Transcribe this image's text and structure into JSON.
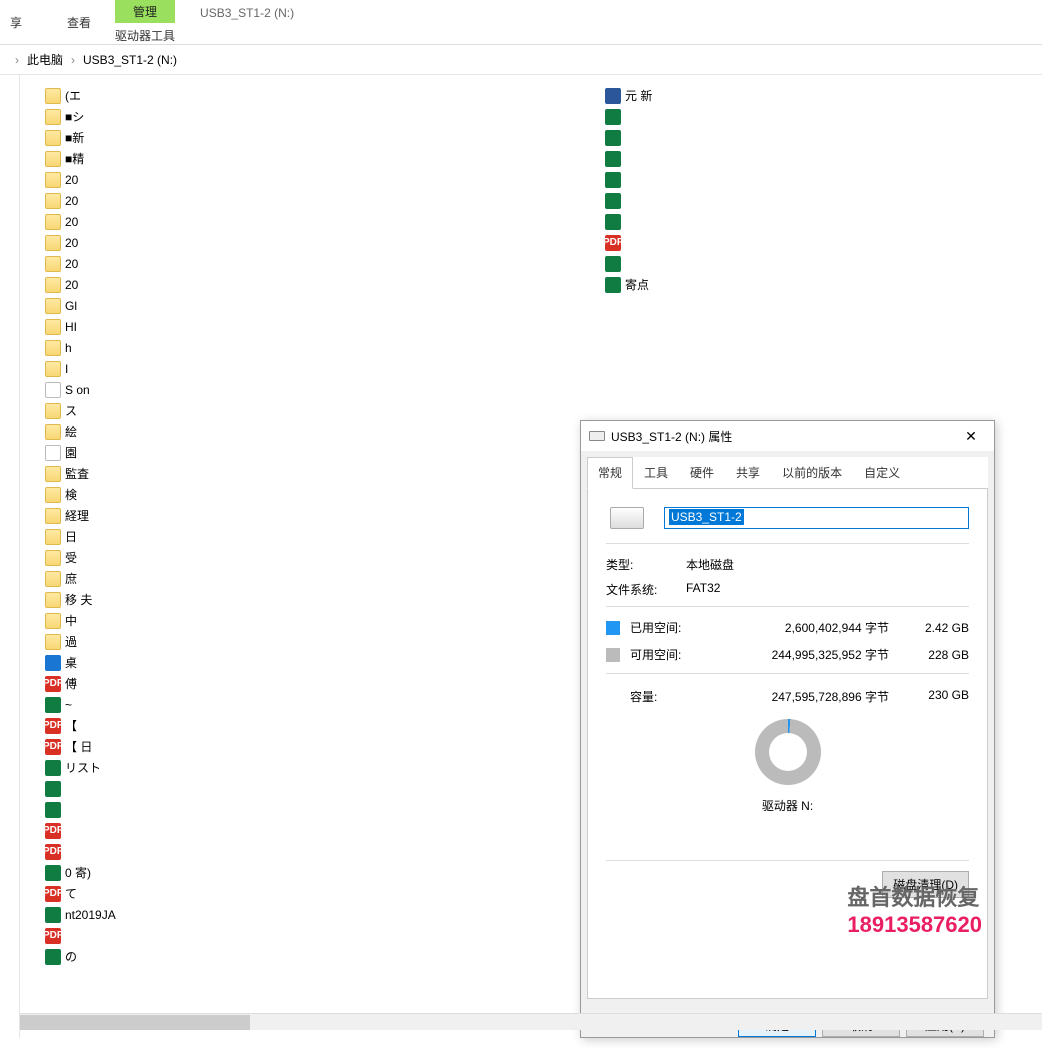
{
  "ribbon": {
    "context_tab": "管理",
    "context_label": "驱动器工具",
    "items": [
      "享",
      "查看"
    ],
    "drive_title": "USB3_ST1-2 (N:)"
  },
  "breadcrumb": {
    "sep": "›",
    "items": [
      "此电脑",
      "USB3_ST1-2 (N:)"
    ]
  },
  "files_col1": [
    {
      "icon": "folder",
      "label": "(エ"
    },
    {
      "icon": "folder",
      "label": "■シ"
    },
    {
      "icon": "folder",
      "label": "■新"
    },
    {
      "icon": "folder",
      "label": "■精"
    },
    {
      "icon": "folder",
      "label": "20"
    },
    {
      "icon": "folder",
      "label": "20"
    },
    {
      "icon": "folder",
      "label": "20"
    },
    {
      "icon": "folder",
      "label": "20"
    },
    {
      "icon": "folder",
      "label": "20"
    },
    {
      "icon": "folder",
      "label": "20"
    },
    {
      "icon": "folder",
      "label": "Gl"
    },
    {
      "icon": "folder",
      "label": "HI"
    },
    {
      "icon": "folder",
      "label": "h"
    },
    {
      "icon": "folder",
      "label": "I"
    },
    {
      "icon": "txt",
      "label": "S                                on"
    },
    {
      "icon": "folder",
      "label": "ス"
    },
    {
      "icon": "folder",
      "label": "絵"
    },
    {
      "icon": "txt",
      "label": "園"
    },
    {
      "icon": "folder",
      "label": "監査"
    },
    {
      "icon": "folder",
      "label": "検"
    },
    {
      "icon": "folder",
      "label": "経理"
    },
    {
      "icon": "folder",
      "label": "日"
    },
    {
      "icon": "folder",
      "label": "受"
    },
    {
      "icon": "folder",
      "label": "庶"
    },
    {
      "icon": "folder",
      "label": "移          夫"
    },
    {
      "icon": "folder",
      "label": "中"
    },
    {
      "icon": "folder",
      "label": "過"
    },
    {
      "icon": "desktop",
      "label": "桌"
    },
    {
      "icon": "pdf",
      "label": "傅"
    },
    {
      "icon": "xls",
      "label": "~"
    },
    {
      "icon": "pdf",
      "label": "【"
    },
    {
      "icon": "pdf",
      "label": "【                       日"
    },
    {
      "icon": "xls",
      "label": "                                        リスト"
    },
    {
      "icon": "xls",
      "label": ""
    },
    {
      "icon": "xls",
      "label": ""
    },
    {
      "icon": "pdf",
      "label": ""
    },
    {
      "icon": "pdf",
      "label": ""
    },
    {
      "icon": "xls",
      "label": "                           0            寄)"
    },
    {
      "icon": "pdf",
      "label": "                                  て"
    },
    {
      "icon": "xls",
      "label": "                              nt2019JA"
    },
    {
      "icon": "pdf",
      "label": ""
    },
    {
      "icon": "xls",
      "label": "                        の"
    }
  ],
  "files_col2": [
    {
      "icon": "doc",
      "label": "          元          新"
    },
    {
      "icon": "xls",
      "label": ""
    },
    {
      "icon": "xls",
      "label": ""
    },
    {
      "icon": "xls",
      "label": ""
    },
    {
      "icon": "xls",
      "label": ""
    },
    {
      "icon": "xls",
      "label": ""
    },
    {
      "icon": "xls",
      "label": ""
    },
    {
      "icon": "pdf",
      "label": ""
    },
    {
      "icon": "xls",
      "label": ""
    },
    {
      "icon": "xls",
      "label": "                       寄点"
    }
  ],
  "dialog": {
    "title": "USB3_ST1-2 (N:) 属性",
    "tabs": [
      "常规",
      "工具",
      "硬件",
      "共享",
      "以前的版本",
      "自定义"
    ],
    "name_value": "USB3_ST1-2",
    "type_label": "类型:",
    "type_value": "本地磁盘",
    "fs_label": "文件系统:",
    "fs_value": "FAT32",
    "used_label": "已用空间:",
    "used_bytes": "2,600,402,944 字节",
    "used_gb": "2.42 GB",
    "free_label": "可用空间:",
    "free_bytes": "244,995,325,952 字节",
    "free_gb": "228 GB",
    "cap_label": "容量:",
    "cap_bytes": "247,595,728,896 字节",
    "cap_gb": "230 GB",
    "drive_label": "驱动器 N:",
    "cleanup": "磁盘清理(D)",
    "ok": "确定",
    "cancel": "取消",
    "apply": "应用(A)"
  },
  "watermark": {
    "line1": "盘首数据恢复",
    "line2": "18913587620"
  }
}
